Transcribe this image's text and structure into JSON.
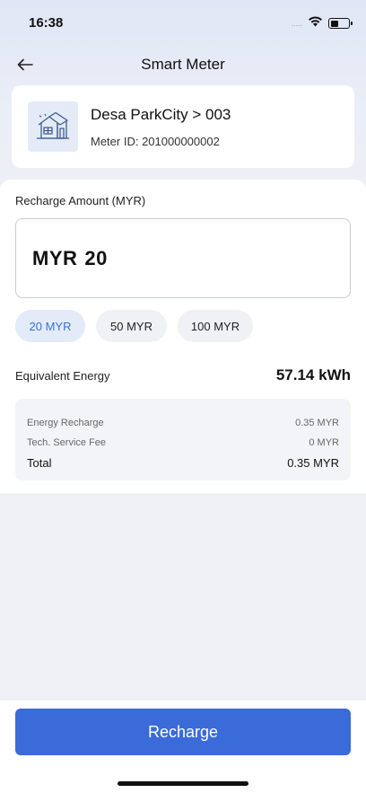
{
  "status_bar": {
    "time": "16:38",
    "signal": "....."
  },
  "nav": {
    "title": "Smart Meter",
    "back_icon": "arrow-left-icon"
  },
  "property": {
    "icon": "house-icon",
    "name": "Desa ParkCity > 003",
    "meter_id": "Meter ID: 201000000002"
  },
  "recharge": {
    "label": "Recharge Amount (MYR)",
    "currency": "MYR",
    "amount": "20",
    "options": [
      {
        "label": "20 MYR",
        "selected": true
      },
      {
        "label": "50 MYR",
        "selected": false
      },
      {
        "label": "100 MYR",
        "selected": false
      }
    ]
  },
  "energy": {
    "label": "Equivalent Energy",
    "value": "57.14 kWh"
  },
  "fees": {
    "rows": [
      {
        "label": "Energy Recharge",
        "value": "0.35 MYR"
      },
      {
        "label": "Tech. Service Fee",
        "value": "0 MYR"
      }
    ],
    "total_label": "Total",
    "total_value": "0.35 MYR"
  },
  "footer": {
    "button_label": "Recharge"
  },
  "colors": {
    "accent": "#3b6ad9",
    "chip_selected_bg": "#e3ebf9",
    "chip_selected_text": "#3a6fd8"
  }
}
